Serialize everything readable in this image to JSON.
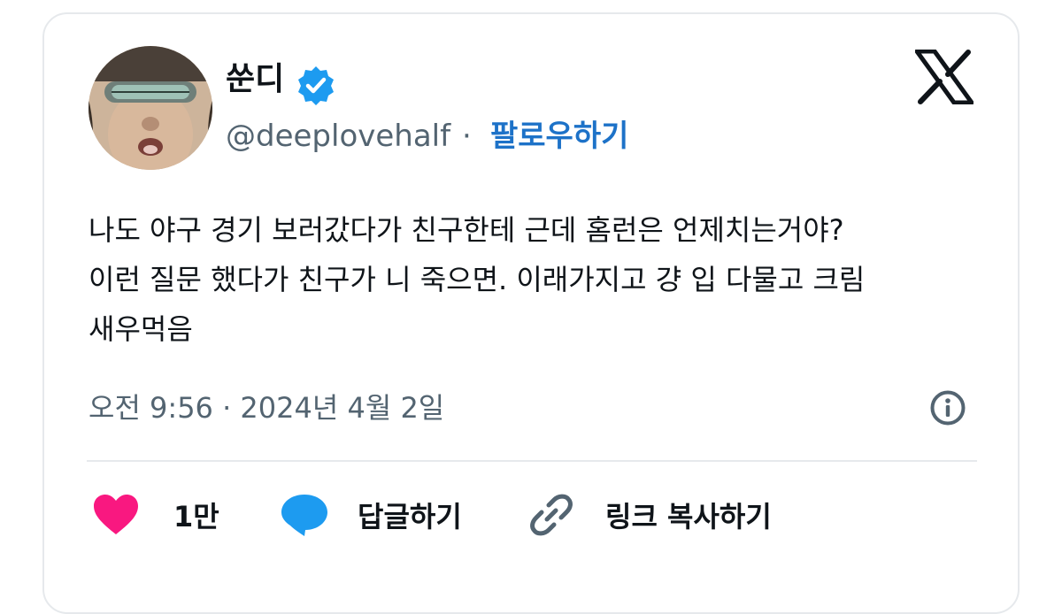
{
  "author": {
    "name": "쑨디",
    "handle": "@deeplovehalf",
    "separator": "·",
    "follow_label": "팔로우하기",
    "verified": true
  },
  "tweet": {
    "text": "나도 야구 경기 보러갔다가 친구한테 근데 홈런은 언제치는거야?\n이런 질문 했다가 친구가 니 죽으면. 이래가지고 걍 입 다물고 크림\n새우먹음",
    "timestamp": "오전 9:56 · 2024년 4월 2일"
  },
  "actions": {
    "like_count": "1만",
    "reply_label": "답글하기",
    "copy_link_label": "링크 복사하기"
  },
  "icons": {
    "verified": "verified-badge-icon",
    "logo": "x-logo-icon",
    "info": "info-icon",
    "like": "heart-icon",
    "reply": "speech-bubble-icon",
    "link": "link-icon"
  },
  "colors": {
    "text": "#0f1419",
    "secondary": "#536471",
    "link": "#1d72c8",
    "verified": "#1d9bf0",
    "heart": "#f91880",
    "reply": "#1d9bf0"
  }
}
